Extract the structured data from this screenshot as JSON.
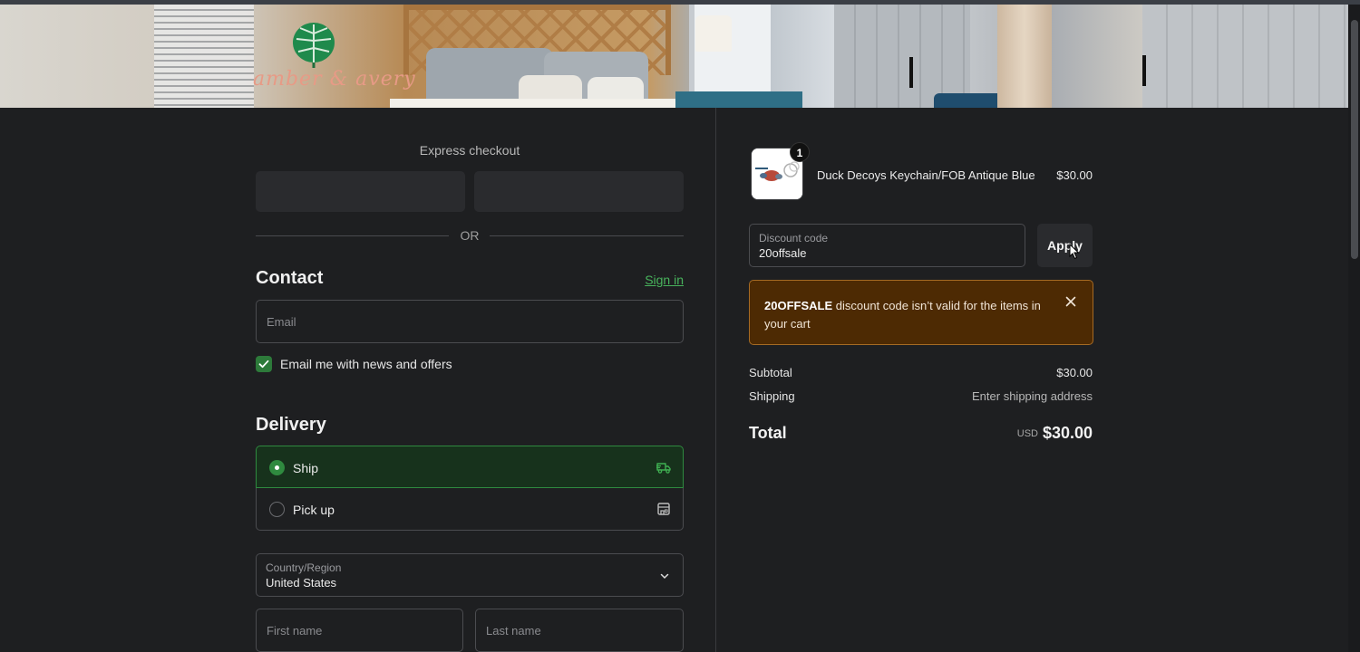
{
  "banner": {
    "logo_text": "amber & avery"
  },
  "express": {
    "title": "Express checkout",
    "or": "OR"
  },
  "contact": {
    "heading": "Contact",
    "sign_in": "Sign in",
    "email_placeholder": "Email",
    "newsletter_label": "Email me with news and offers",
    "newsletter_checked": true
  },
  "delivery": {
    "heading": "Delivery",
    "options": [
      {
        "label": "Ship",
        "selected": true,
        "icon": "truck-icon"
      },
      {
        "label": "Pick up",
        "selected": false,
        "icon": "store-icon"
      }
    ],
    "country_label": "Country/Region",
    "country_value": "United States",
    "first_name_placeholder": "First name",
    "last_name_placeholder": "Last name"
  },
  "order": {
    "item": {
      "name": "Duck Decoys Keychain/FOB Antique Blue",
      "price": "$30.00",
      "quantity": "1"
    },
    "discount": {
      "label": "Discount code",
      "value": "20offsale",
      "apply_label": "Apply"
    },
    "alert": {
      "code": "20OFFSALE",
      "message": " discount code isn’t valid for the items in your cart"
    },
    "subtotal_label": "Subtotal",
    "subtotal_value": "$30.00",
    "shipping_label": "Shipping",
    "shipping_value": "Enter shipping address",
    "total_label": "Total",
    "total_currency": "USD",
    "total_value": "$30.00"
  },
  "colors": {
    "accent": "#2f8a3f",
    "link": "#48b35c",
    "alert_bg": "#4d2a03",
    "alert_border": "#a56a23",
    "page_bg": "#1e1f21"
  }
}
